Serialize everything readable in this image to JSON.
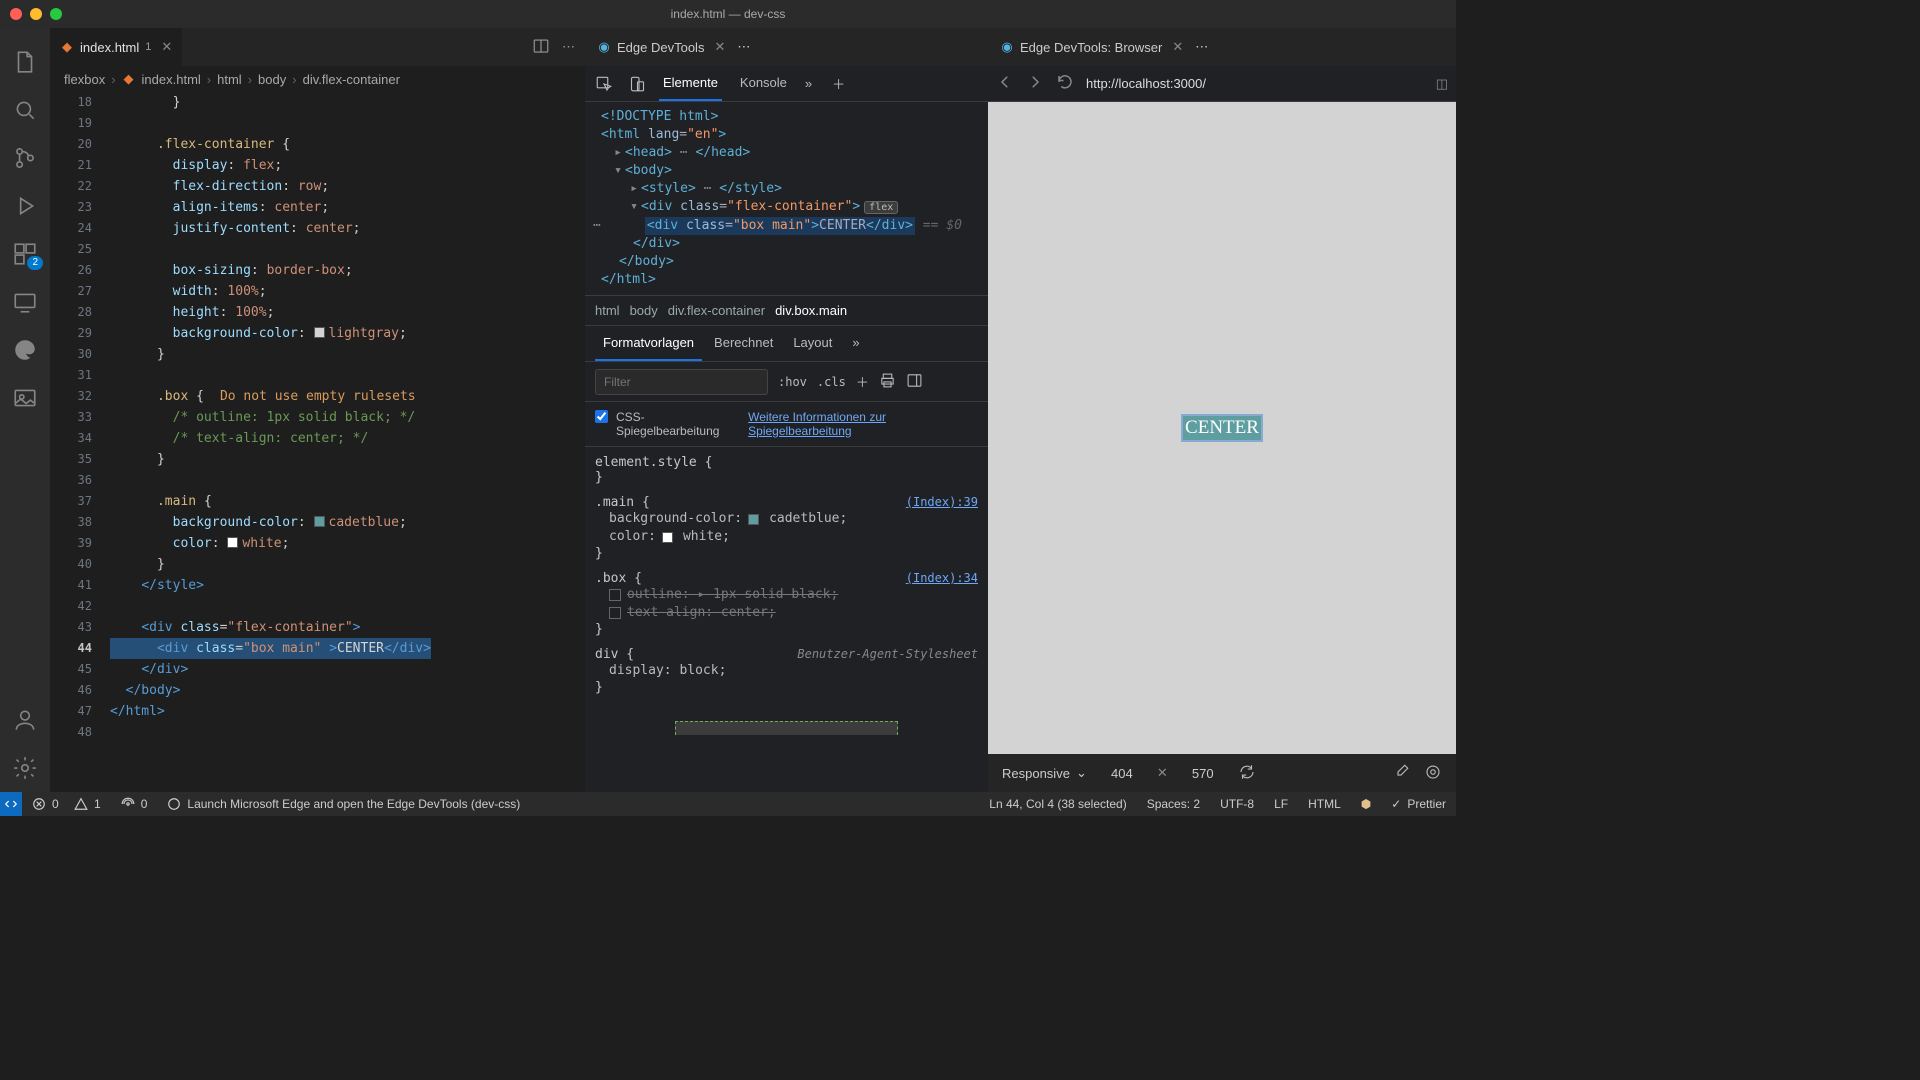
{
  "window_title": "index.html — dev-css",
  "editor_tab": {
    "filename": "index.html",
    "modified_count": "1"
  },
  "devtools_tab": "Edge DevTools",
  "browser_tab": "Edge DevTools: Browser",
  "breadcrumbs": [
    "flexbox",
    "index.html",
    "html",
    "body",
    "div.flex-container"
  ],
  "gutter": [
    "18",
    "19",
    "20",
    "21",
    "22",
    "23",
    "24",
    "25",
    "26",
    "27",
    "28",
    "29",
    "30",
    "31",
    "32",
    "33",
    "34",
    "35",
    "36",
    "37",
    "38",
    "39",
    "40",
    "41",
    "42",
    "43",
    "44",
    "45",
    "46",
    "47",
    "48"
  ],
  "current_line": "44",
  "warn_line32": "Do not use empty rulesets",
  "devtools_tabs": {
    "elements": "Elemente",
    "console": "Konsole"
  },
  "dom_crumbs": [
    "html",
    "body",
    "div.flex-container",
    "div.box.main"
  ],
  "styles_tabs": {
    "a": "Formatvorlagen",
    "b": "Berechnet",
    "c": "Layout"
  },
  "filter_placeholder": "Filter",
  "hov": ":hov",
  "cls": ".cls",
  "mirror_label": "CSS-Spiegelbearbeitung",
  "mirror_link": "Weitere Informationen zur Spiegelbearbeitung",
  "rules": {
    "element_style": "element.style {",
    "main_sel": ".main {",
    "main_src": "(Index):39",
    "main_p1": "background-color:",
    "main_p1v": "cadetblue;",
    "main_p2": "color:",
    "main_p2v": "white;",
    "box_sel": ".box {",
    "box_src": "(Index):34",
    "box_p1": "outline: ▸ 1px solid   black;",
    "box_p2": "text-align: center;",
    "div_sel": "div {",
    "div_src": "Benutzer-Agent-Stylesheet",
    "div_p": "display: block;"
  },
  "url": "http://localhost:3000/",
  "center_text": "CENTER",
  "viewport": {
    "mode": "Responsive",
    "w": "404",
    "h": "570"
  },
  "status": {
    "errors": "0",
    "warnings": "1",
    "port": "0",
    "launch": "Launch Microsoft Edge and open the Edge DevTools (dev-css)",
    "selection": "Ln 44, Col 4 (38 selected)",
    "spaces": "Spaces: 2",
    "enc": "UTF-8",
    "eol": "LF",
    "lang": "HTML",
    "prettier": "Prettier"
  }
}
